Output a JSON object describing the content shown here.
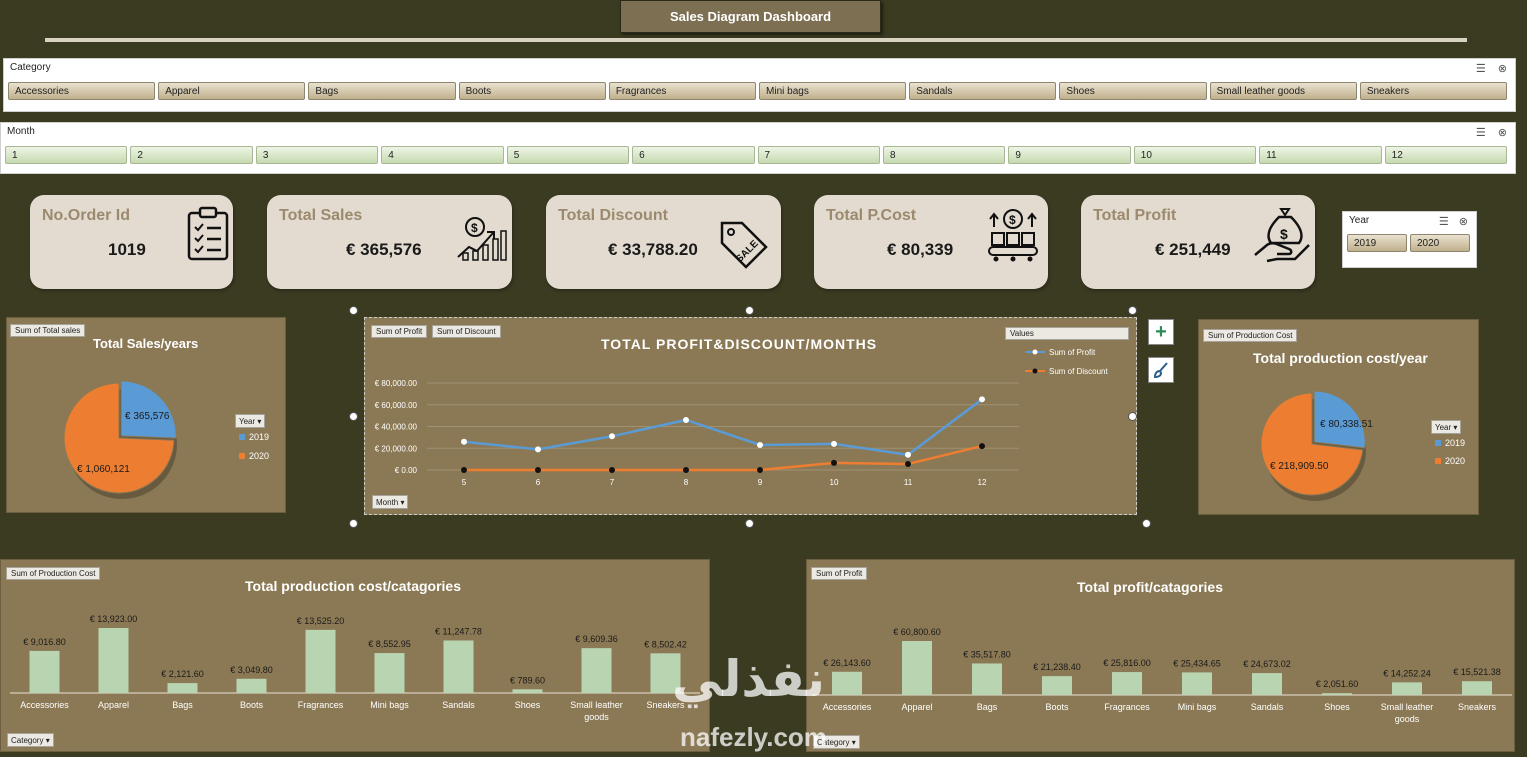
{
  "header": {
    "title": "Sales Diagram Dashboard"
  },
  "category_slicer": {
    "label": "Category",
    "items": [
      "Accessories",
      "Apparel",
      "Bags",
      "Boots",
      "Fragrances",
      "Mini bags",
      "Sandals",
      "Shoes",
      "Small leather goods",
      "Sneakers"
    ]
  },
  "month_slicer": {
    "label": "Month",
    "items": [
      "1",
      "2",
      "3",
      "4",
      "5",
      "6",
      "7",
      "8",
      "9",
      "10",
      "11",
      "12"
    ]
  },
  "kpis": [
    {
      "title": "No.Order Id",
      "value": "1019",
      "icon": "clipboard-checklist-icon"
    },
    {
      "title": "Total Sales",
      "value": "€ 365,576",
      "icon": "sales-growth-chart-icon"
    },
    {
      "title": "Total Discount",
      "value": "€ 33,788.20",
      "icon": "sale-tag-icon"
    },
    {
      "title": "Total P.Cost",
      "value": "€ 80,339",
      "icon": "production-conveyor-icon"
    },
    {
      "title": "Total Profit",
      "value": "€ 251,449",
      "icon": "money-bag-hand-icon"
    }
  ],
  "year_slicer": {
    "label": "Year",
    "items": [
      "2019",
      "2020"
    ]
  },
  "colors": {
    "blue": "#5b9bd5",
    "orange": "#ed7d31",
    "bar_green": "#b8d4b0",
    "panel": "#8b7955",
    "background": "#3b3b22"
  },
  "sales_pie": {
    "field": "Sum of Total sales",
    "title": "Total Sales/years",
    "legend_button": "Year",
    "chart_data": {
      "type": "pie",
      "labels": [
        "2019",
        "2020"
      ],
      "values": [
        365576,
        1060121
      ],
      "data_labels": [
        "€ 365,576",
        "€ 1,060,121"
      ]
    }
  },
  "line_chart": {
    "fields": [
      "Sum of Profit",
      "Sum of Discount"
    ],
    "title": "TOTAL PROFIT&DISCOUNT/MONTHS",
    "legend_title": "Values",
    "axis_button": "Month",
    "chart_data": {
      "type": "line",
      "x": [
        "5",
        "6",
        "7",
        "8",
        "9",
        "10",
        "11",
        "12"
      ],
      "series": [
        {
          "name": "Sum of Profit",
          "values": [
            26000,
            19000,
            31000,
            46000,
            23000,
            24000,
            14000,
            65000
          ]
        },
        {
          "name": "Sum of Discount",
          "values": [
            0,
            0,
            0,
            0,
            0,
            6500,
            5500,
            22000
          ]
        }
      ],
      "ylim": [
        0,
        80000
      ],
      "yticks": [
        "€ 0.00",
        "€ 20,000.00",
        "€ 40,000.00",
        "€ 60,000.00",
        "€ 80,000.00"
      ],
      "grid": true,
      "legend": "top-right"
    }
  },
  "cost_pie": {
    "field": "Sum of  Production Cost",
    "title": "Total production cost/year",
    "legend_button": "Year",
    "chart_data": {
      "type": "pie",
      "labels": [
        "2019",
        "2020"
      ],
      "values": [
        80338.51,
        218909.5
      ],
      "data_labels": [
        "€ 80,338.51",
        "€ 218,909.50"
      ]
    }
  },
  "cost_bars": {
    "field": "Sum of  Production Cost",
    "title": "Total production cost/catagories",
    "axis_button": "Category",
    "chart_data": {
      "type": "bar",
      "categories": [
        "Accessories",
        "Apparel",
        "Bags",
        "Boots",
        "Fragrances",
        "Mini bags",
        "Sandals",
        "Shoes",
        "Small leather goods",
        "Sneakers"
      ],
      "values": [
        9016.8,
        13923.0,
        2121.6,
        3049.8,
        13525.2,
        8552.95,
        11247.78,
        789.6,
        9609.36,
        8502.42
      ],
      "data_labels": [
        "€ 9,016.80",
        "€ 13,923.00",
        "€ 2,121.60",
        "€ 3,049.80",
        "€ 13,525.20",
        "€ 8,552.95",
        "€ 11,247.78",
        "€ 789.60",
        "€ 9,609.36",
        "€ 8,502.42"
      ]
    }
  },
  "profit_bars": {
    "field": "Sum of Profit",
    "title": "Total profit/catagories",
    "axis_button": "Category",
    "chart_data": {
      "type": "bar",
      "categories": [
        "Accessories",
        "Apparel",
        "Bags",
        "Boots",
        "Fragrances",
        "Mini bags",
        "Sandals",
        "Shoes",
        "Small leather goods",
        "Sneakers"
      ],
      "values": [
        26143.6,
        60800.6,
        35517.8,
        21238.4,
        25816.0,
        25434.65,
        24673.02,
        2051.6,
        14252.24,
        15521.38
      ],
      "data_labels": [
        "€ 26,143.60",
        "€ 60,800.60",
        "€ 35,517.80",
        "€ 21,238.40",
        "€ 25,816.00",
        "€ 25,434.65",
        "€ 24,673.02",
        "€ 2,051.60",
        "€ 14,252.24",
        "€ 15,521.38"
      ]
    }
  },
  "watermark": {
    "arabic": "نفذلي",
    "latin": "nafezly.com"
  }
}
